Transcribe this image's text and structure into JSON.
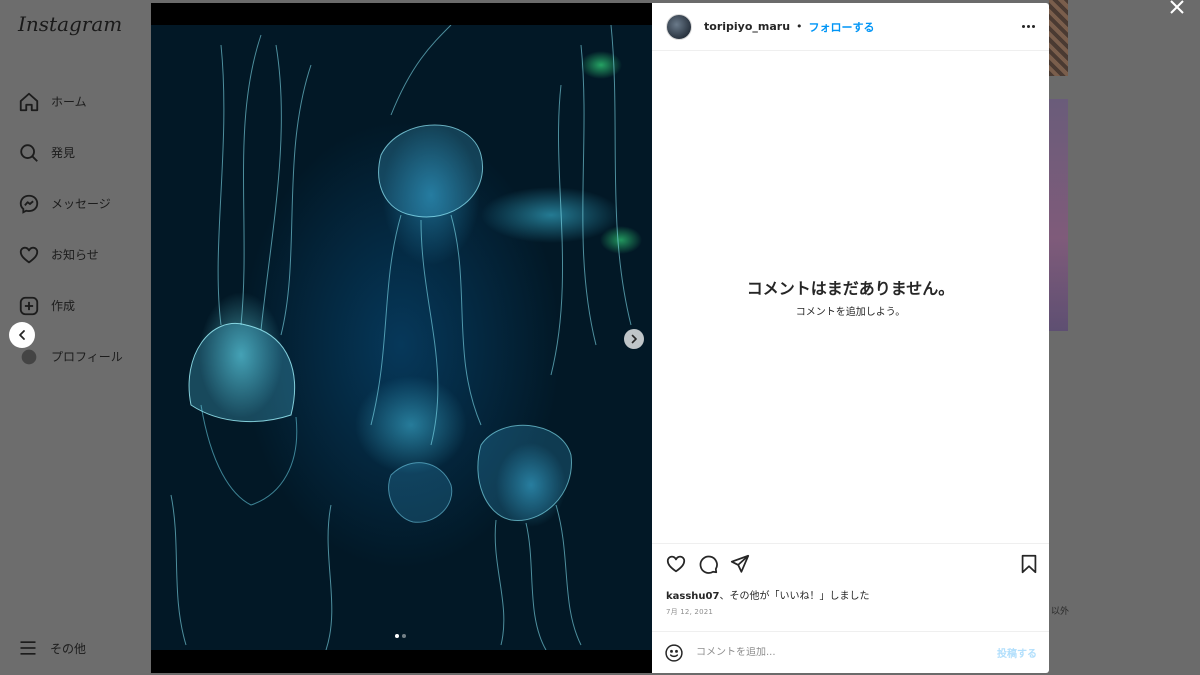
{
  "app": {
    "logo": "Instagram"
  },
  "sidebar": {
    "items": [
      {
        "label": "ホーム",
        "icon": "home-icon"
      },
      {
        "label": "発見",
        "icon": "search-icon"
      },
      {
        "label": "メッセージ",
        "icon": "messenger-icon"
      },
      {
        "label": "お知らせ",
        "icon": "heart-icon"
      },
      {
        "label": "作成",
        "icon": "create-icon"
      },
      {
        "label": "プロフィール",
        "icon": "avatar-icon"
      }
    ],
    "more_label": "その他"
  },
  "background": {
    "peek_text": "以外"
  },
  "post": {
    "username": "toripiyo_maru",
    "separator": "•",
    "follow_label": "フォローする",
    "image_subject": "jellyfish-aquarium-photo",
    "carousel": {
      "count": 2,
      "active_index": 0
    },
    "comments": {
      "empty_title": "コメントはまだありません。",
      "empty_subtitle": "コメントを追加しよう。"
    },
    "likes": {
      "user": "kasshu07",
      "suffix": "、その他が「いいね！」しました"
    },
    "date": "7月 12, 2021",
    "comment_box": {
      "placeholder": "コメントを追加...",
      "post_label": "投稿する"
    }
  },
  "colors": {
    "accent": "#0095f6",
    "overlay": "#3f3f3f",
    "post_disabled": "#b2dffc"
  }
}
